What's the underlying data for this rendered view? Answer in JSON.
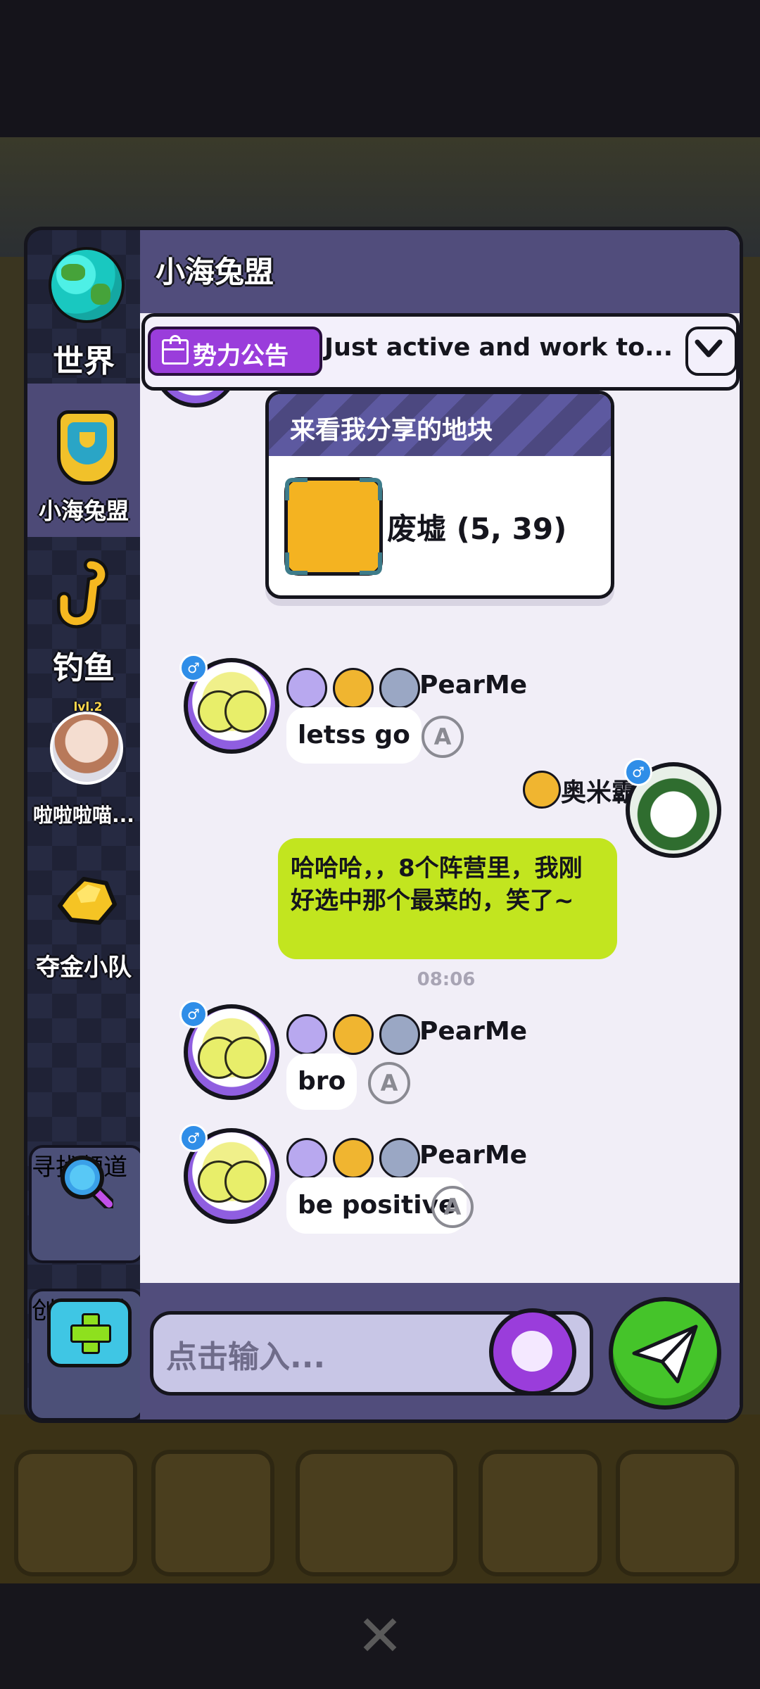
{
  "sidebar": {
    "items": [
      {
        "label": "世界"
      },
      {
        "label": "小海兔盟"
      },
      {
        "label": "钓鱼"
      },
      {
        "label": "啦啦啦喵...",
        "level": "lvl.2"
      },
      {
        "label": "夺金小队"
      }
    ],
    "find_channel": "寻找频道",
    "create_channel": "创建频道"
  },
  "header": {
    "title": "小海兔盟"
  },
  "announcement": {
    "tag": "势力公告",
    "text": "Just active and work to..."
  },
  "share_card": {
    "title": "来看我分享的地块",
    "location": "废墟 (5, 39)"
  },
  "messages": [
    {
      "user": "PearMe",
      "text": "letss go",
      "gender": "♂"
    },
    {
      "user": "奥米霸",
      "text": "哈哈哈，，8个阵营里，我刚好选中那个最菜的，笑了~",
      "gender": "♂"
    },
    {
      "user": "PearMe",
      "text": "bro",
      "gender": "♂"
    },
    {
      "user": "PearMe",
      "text": "be positive",
      "gender": "♂"
    }
  ],
  "timestamp": "08:06",
  "input": {
    "placeholder": "点击输入..."
  },
  "colors": {
    "accent_purple": "#9a3ddb",
    "send_green": "#45c42a",
    "my_bubble": "#c2e51f",
    "header": "#514d7c"
  }
}
